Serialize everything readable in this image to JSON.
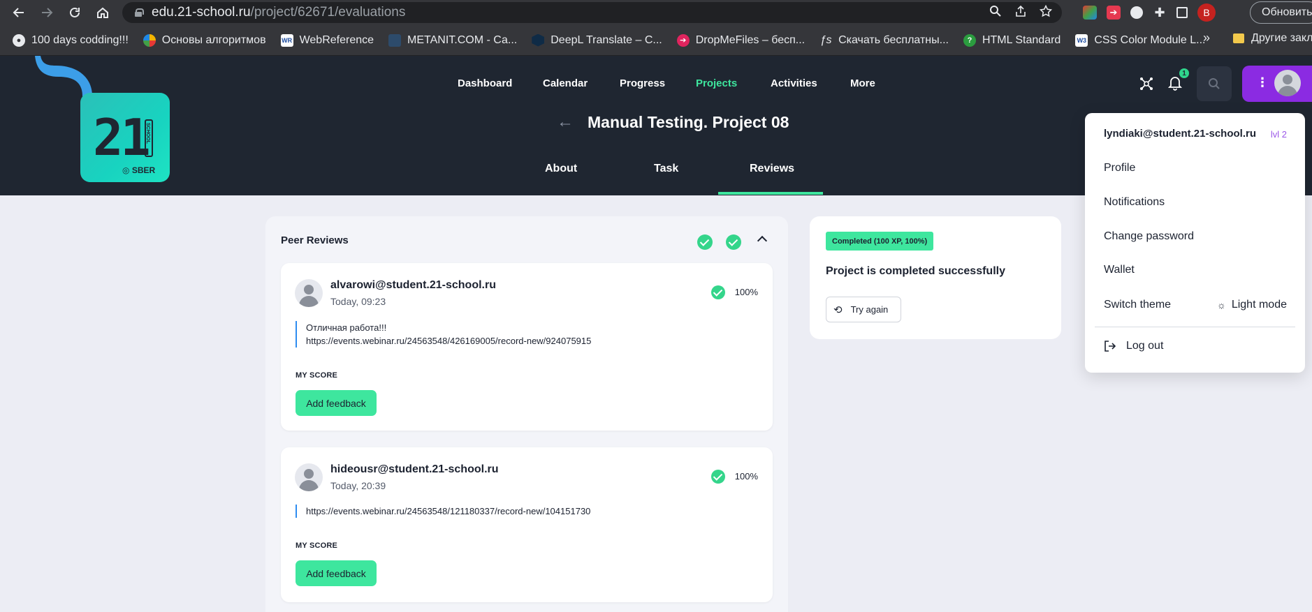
{
  "browser": {
    "url_host": "edu.21-school.ru",
    "url_path": "/project/62671/evaluations",
    "update_label": "Обновить",
    "profile_letter": "B",
    "bookmarks": [
      {
        "label": "100 days codding!!!",
        "icon": "github-icon",
        "color": "#1b1f23"
      },
      {
        "label": "Основы алгоритмов",
        "icon": "circle-logo-icon",
        "color": "#f2b400"
      },
      {
        "label": "WebReference",
        "icon": "wr-icon",
        "color": "#ffffff"
      },
      {
        "label": "METANIT.COM - Са...",
        "icon": "metanit-icon",
        "color": "#2d4b6b"
      },
      {
        "label": "DeepL Translate – С...",
        "icon": "deepl-icon",
        "color": "#0f2b46"
      },
      {
        "label": "DropMeFiles – бесп...",
        "icon": "dropmefiles-icon",
        "color": "#e0245e"
      },
      {
        "label": "Скачать бесплатны...",
        "icon": "fs-icon",
        "color": "#35363a"
      },
      {
        "label": "HTML Standard",
        "icon": "whatwg-icon",
        "color": "#2b9d3f"
      },
      {
        "label": "CSS Color Module L...",
        "icon": "w3c-icon",
        "color": "#ffffff"
      }
    ],
    "other_bookmarks": "Другие закл"
  },
  "header": {
    "logo": {
      "number": "21",
      "school": "SCHOOL",
      "sber": "SBER"
    },
    "nav": [
      {
        "label": "Dashboard",
        "active": false
      },
      {
        "label": "Calendar",
        "active": false
      },
      {
        "label": "Progress",
        "active": false
      },
      {
        "label": "Projects",
        "active": true
      },
      {
        "label": "Activities",
        "active": false
      },
      {
        "label": "More",
        "active": false
      }
    ],
    "notifications_count": "1",
    "project_title": "Manual Testing. Project 08",
    "tabs": [
      {
        "label": "About",
        "active": false
      },
      {
        "label": "Task",
        "active": false
      },
      {
        "label": "Reviews",
        "active": true
      }
    ]
  },
  "peer_reviews": {
    "title": "Peer Reviews",
    "reviews": [
      {
        "user": "alvarowi@student.21-school.ru",
        "time": "Today, 09:23",
        "score": "100%",
        "comment_lines": [
          "Отличная работа!!!",
          "https://events.webinar.ru/24563548/426169005/record-new/924075915"
        ],
        "my_score_label": "MY SCORE",
        "button_label": "Add feedback"
      },
      {
        "user": "hideousr@student.21-school.ru",
        "time": "Today, 20:39",
        "score": "100%",
        "comment_lines": [
          "https://events.webinar.ru/24563548/121180337/record-new/104151730"
        ],
        "my_score_label": "MY SCORE",
        "button_label": "Add feedback"
      }
    ]
  },
  "status": {
    "badge": "Completed (100 XP, 100%)",
    "title": "Project is completed successfully",
    "button_label": "Try again"
  },
  "user_menu": {
    "email": "lyndiaki@student.21-school.ru",
    "level": "lvl 2",
    "items": [
      "Profile",
      "Notifications",
      "Change password",
      "Wallet",
      "Switch theme"
    ],
    "theme_label": "Light mode",
    "logout": "Log out"
  },
  "colors": {
    "accent_green": "#3ee69e",
    "header_bg": "#1f2631",
    "purple": "#8b2be2"
  }
}
